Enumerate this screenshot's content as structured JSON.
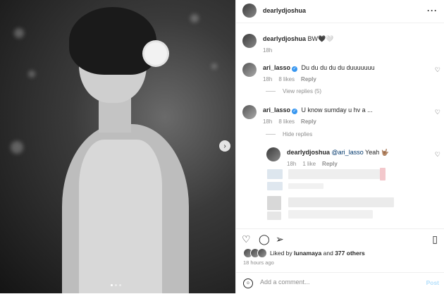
{
  "post": {
    "username": "dearlydjoshua",
    "caption": {
      "username": "dearlydjoshua",
      "text": "BW🖤🤍",
      "time": "18h"
    }
  },
  "comments": [
    {
      "username": "ari_lasso",
      "text": "Du du du du du duuuuuuu",
      "time": "18h",
      "likes": "8 likes",
      "reply": "Reply",
      "thread_toggle": "View replies (5)"
    },
    {
      "username": "ari_lasso",
      "text": "U know sumday u hv a ...",
      "time": "18h",
      "likes": "8 likes",
      "reply": "Reply",
      "thread_toggle": "Hide replies"
    }
  ],
  "reply": {
    "username": "dearlydjoshua",
    "mention": "@ari_lasso",
    "text": "Yeah 🤟🏽",
    "time": "18h",
    "likes": "1 like",
    "reply": "Reply"
  },
  "liked_by": {
    "prefix": "Liked by",
    "user": "lunamaya",
    "and": "and",
    "others": "377 others"
  },
  "time_ago": "18 hours ago",
  "add_comment": {
    "placeholder": "Add a comment...",
    "post_label": "Post"
  },
  "icons": {
    "more": "more-dots-icon",
    "like": "heart-icon",
    "comment": "comment-bubble-icon",
    "share": "paper-plane-icon",
    "save": "bookmark-icon",
    "emoji": "emoji-icon",
    "next": "chevron-right-icon"
  },
  "colors": {
    "link": "#00376b",
    "muted": "#8e8e8e",
    "verified": "#3897f0",
    "post_disabled": "#b2dffc"
  }
}
